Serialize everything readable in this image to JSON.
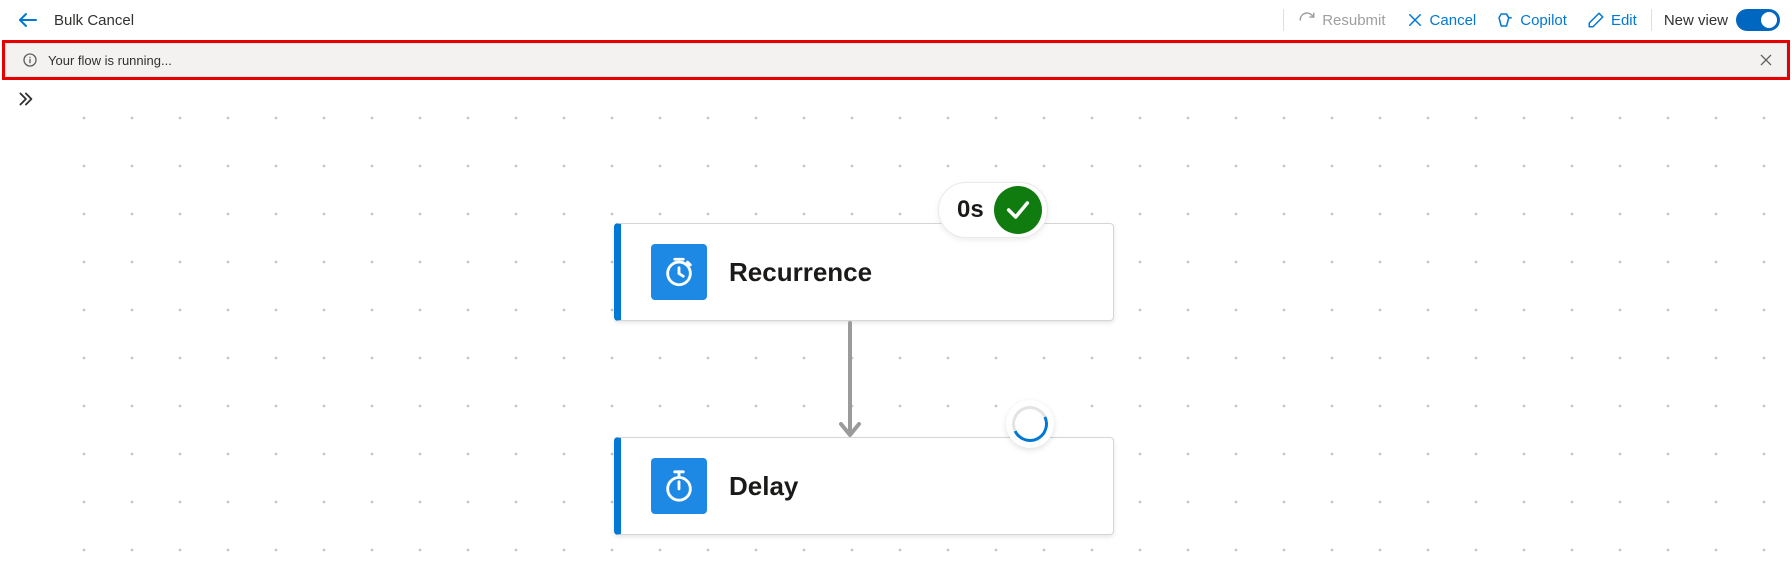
{
  "header": {
    "title": "Bulk Cancel",
    "commands": {
      "resubmit": "Resubmit",
      "cancel": "Cancel",
      "copilot": "Copilot",
      "edit": "Edit"
    },
    "new_view_label": "New view"
  },
  "banner": {
    "message": "Your flow is running..."
  },
  "nodes": {
    "recurrence": {
      "label": "Recurrence",
      "duration": "0s"
    },
    "delay": {
      "label": "Delay"
    }
  }
}
